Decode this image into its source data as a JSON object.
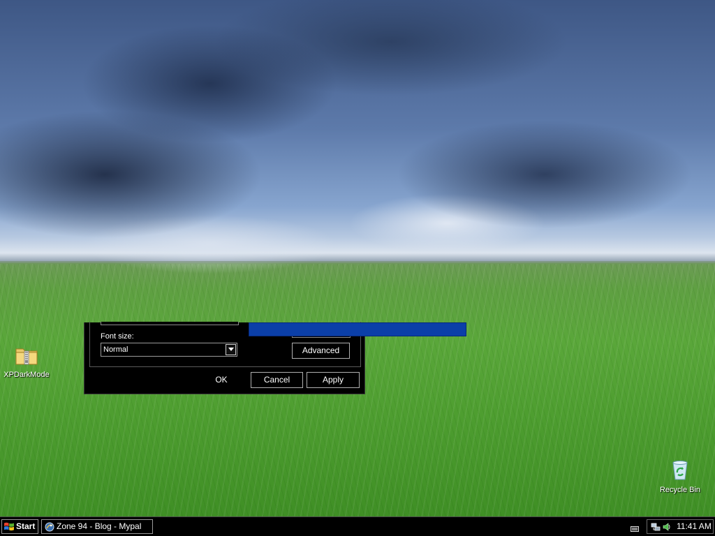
{
  "desktop": {
    "icons": [
      {
        "label": "XPDarkMode",
        "icon": "zip-folder-icon"
      },
      {
        "label": "Recycle Bin",
        "icon": "recycle-bin-icon"
      }
    ]
  },
  "dialog": {
    "font_size_label": "Font size:",
    "font_size_value": "Normal",
    "advanced_label": "Advanced",
    "ok_label": "OK",
    "cancel_label": "Cancel",
    "apply_label": "Apply",
    "accent_color": "#0b3fa8"
  },
  "taskbar": {
    "start_label": "Start",
    "task_label": "Zone 94 - Blog - Mypal",
    "clock": "11:41 AM"
  }
}
